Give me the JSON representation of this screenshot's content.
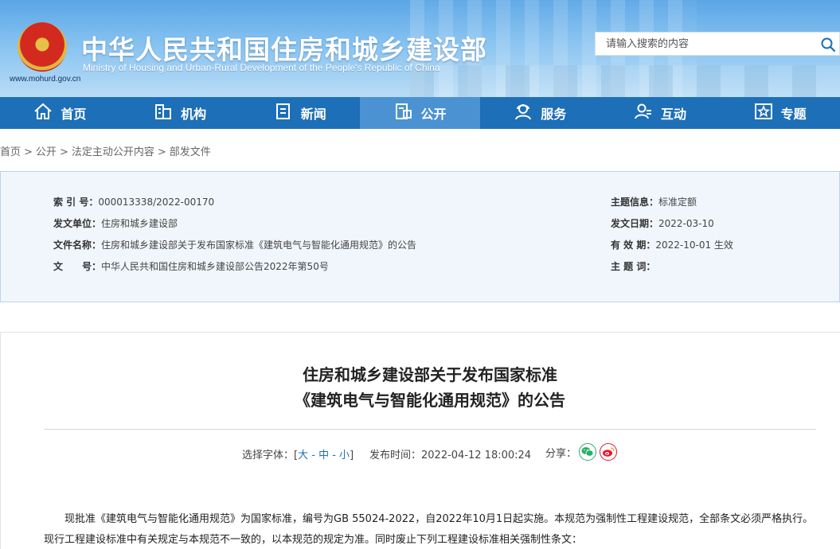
{
  "header": {
    "title": "中华人民共和国住房和城乡建设部",
    "subtitle": "Ministry of Housing and Urban-Rural Development of the People's Republic of China",
    "url": "www.mohurd.gov.cn",
    "search_placeholder": "请输入搜索的内容"
  },
  "nav": {
    "items": [
      {
        "label": "首页",
        "icon": "home-icon"
      },
      {
        "label": "机构",
        "icon": "organization-icon"
      },
      {
        "label": "新闻",
        "icon": "news-icon"
      },
      {
        "label": "公开",
        "icon": "disclosure-icon",
        "active": true
      },
      {
        "label": "服务",
        "icon": "service-icon"
      },
      {
        "label": "互动",
        "icon": "interaction-icon"
      },
      {
        "label": "专题",
        "icon": "topic-icon"
      }
    ]
  },
  "breadcrumb": [
    "首页",
    "公开",
    "法定主动公开内容",
    "部发文件"
  ],
  "info": {
    "index_label": "索 引 号：",
    "index_value": "000013338/2022-00170",
    "issuer_label": "发文单位：",
    "issuer_value": "住房和城乡建设部",
    "docname_label": "文件名称：",
    "docname_value": "住房和城乡建设部关于发布国家标准《建筑电气与智能化通用规范》的公告",
    "docno_label": "文　　号：",
    "docno_value": "中华人民共和国住房和城乡建设部公告2022年第50号",
    "topic_label": "主题信息：",
    "topic_value": "标准定额",
    "date_label": "发文日期：",
    "date_value": "2022-03-10",
    "valid_label": "有 效 期：",
    "valid_value": "2022-10-01 生效",
    "keywords_label": "主 题 词："
  },
  "article": {
    "title_line1": "住房和城乡建设部关于发布国家标准",
    "title_line2": "《建筑电气与智能化通用规范》的公告",
    "font_label": "选择字体：[",
    "font_large": "大",
    "font_dash1": " - ",
    "font_medium": "中",
    "font_dash2": " - ",
    "font_small": "小",
    "font_close": "]",
    "publish_time": "发布时间：2022-04-12 18:00:24",
    "share_label": "分享：",
    "body": "现批准《建筑电气与智能化通用规范》为国家标准，编号为GB 55024-2022，自2022年10月1日起实施。本规范为强制性工程建设规范，全部条文必须严格执行。现行工程建设标准中有关规定与本规范不一致的，以本规范的规定为准。同时废止下列工程建设标准相关强制性条文："
  },
  "colors": {
    "nav_bg": "#1d6fb8",
    "nav_active": "#4b92d3",
    "info_bg": "#f1f6fc",
    "wechat": "#2aae67",
    "weibo": "#e6162d"
  }
}
